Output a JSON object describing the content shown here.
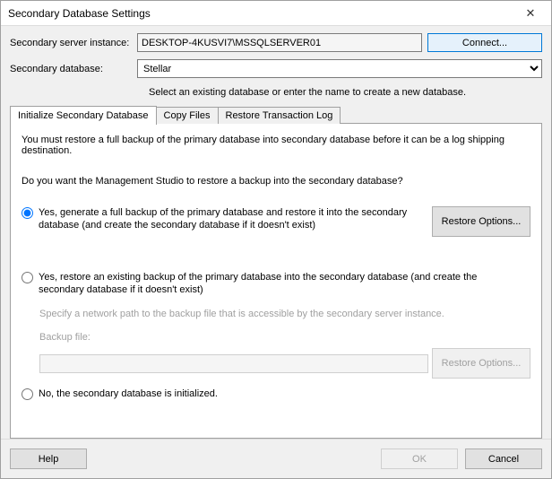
{
  "window": {
    "title": "Secondary Database Settings"
  },
  "fields": {
    "server_label": "Secondary server instance:",
    "server_value": "DESKTOP-4KUSVI7\\MSSQLSERVER01",
    "connect_label": "Connect...",
    "database_label": "Secondary database:",
    "database_value": "Stellar",
    "database_hint": "Select an existing database or enter the name to create a new database."
  },
  "tabs": {
    "t0": "Initialize Secondary Database",
    "t1": "Copy Files",
    "t2": "Restore Transaction Log"
  },
  "panel": {
    "instruction": "You must restore a full backup of the primary database into secondary database before it can be a log shipping destination.",
    "question": "Do you want the Management Studio to restore a backup into the secondary database?",
    "opt1": "Yes, generate a full backup of the primary database and restore it into the secondary database (and create the secondary database if it doesn't exist)",
    "restore_options_label": "Restore Options...",
    "opt2": "Yes, restore an existing backup of the primary database into the secondary database (and create the secondary database if it doesn't exist)",
    "network_path_hint": "Specify a network path to the backup file that is accessible by the secondary server instance.",
    "backup_file_label": "Backup file:",
    "opt3": "No, the secondary database is initialized."
  },
  "footer": {
    "help": "Help",
    "ok": "OK",
    "cancel": "Cancel"
  }
}
